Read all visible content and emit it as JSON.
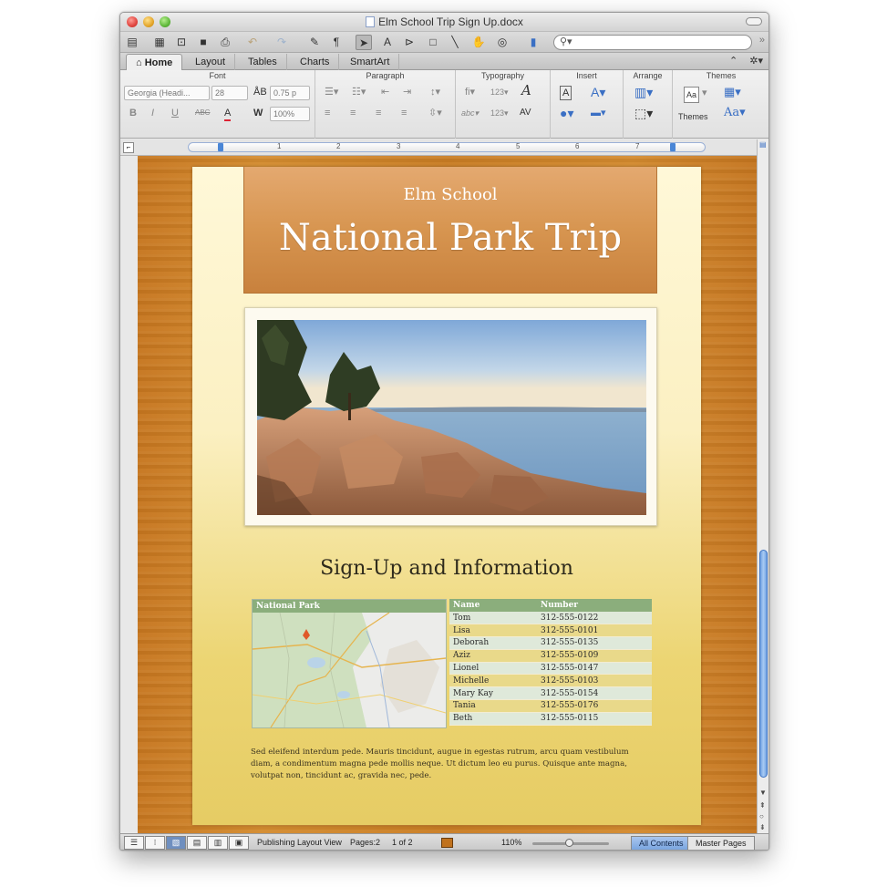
{
  "window": {
    "title": "Elm School Trip Sign Up.docx"
  },
  "ribbon_tabs": [
    "Home",
    "Layout",
    "Tables",
    "Charts",
    "SmartArt"
  ],
  "ribbon": {
    "groups": [
      "Font",
      "Paragraph",
      "Typography",
      "Insert",
      "Arrange",
      "Themes"
    ],
    "font_name": "Georgia (Headi...",
    "font_size": "28",
    "spacing": "0.75 p",
    "scale": "100%",
    "themes_label": "Themes"
  },
  "ruler": {
    "numbers": [
      "1",
      "2",
      "3",
      "4",
      "5",
      "6",
      "7"
    ]
  },
  "document": {
    "school": "Elm School",
    "title": "National Park Trip",
    "section_title": "Sign-Up and Information",
    "map_header": "National Park",
    "table": {
      "headers": [
        "Name",
        "Number"
      ],
      "rows": [
        [
          "Tom",
          "312-555-0122"
        ],
        [
          "Lisa",
          "312-555-0101"
        ],
        [
          "Deborah",
          "312-555-0135"
        ],
        [
          "Aziz",
          "312-555-0109"
        ],
        [
          "Lionel",
          "312-555-0147"
        ],
        [
          "Michelle",
          "312-555-0103"
        ],
        [
          "Mary Kay",
          "312-555-0154"
        ],
        [
          "Tania",
          "312-555-0176"
        ],
        [
          "Beth",
          "312-555-0115"
        ]
      ]
    },
    "body_text": "Sed eleifend interdum pede. Mauris tincidunt, augue in egestas rutrum, arcu quam vestibulum diam, a condimentum magna pede mollis neque. Ut dictum leo eu purus. Quisque ante magna, volutpat non, tincidunt ac, gravida nec, pede."
  },
  "status": {
    "view": "Publishing Layout View",
    "pages": "Pages:2",
    "page_of": "1 of 2",
    "zoom": "110%",
    "tab_all": "All Contents",
    "tab_master": "Master Pages"
  },
  "colors": {
    "accent_table": "#8bae7c",
    "banner": "#d79550",
    "wood": "#c97d24"
  }
}
